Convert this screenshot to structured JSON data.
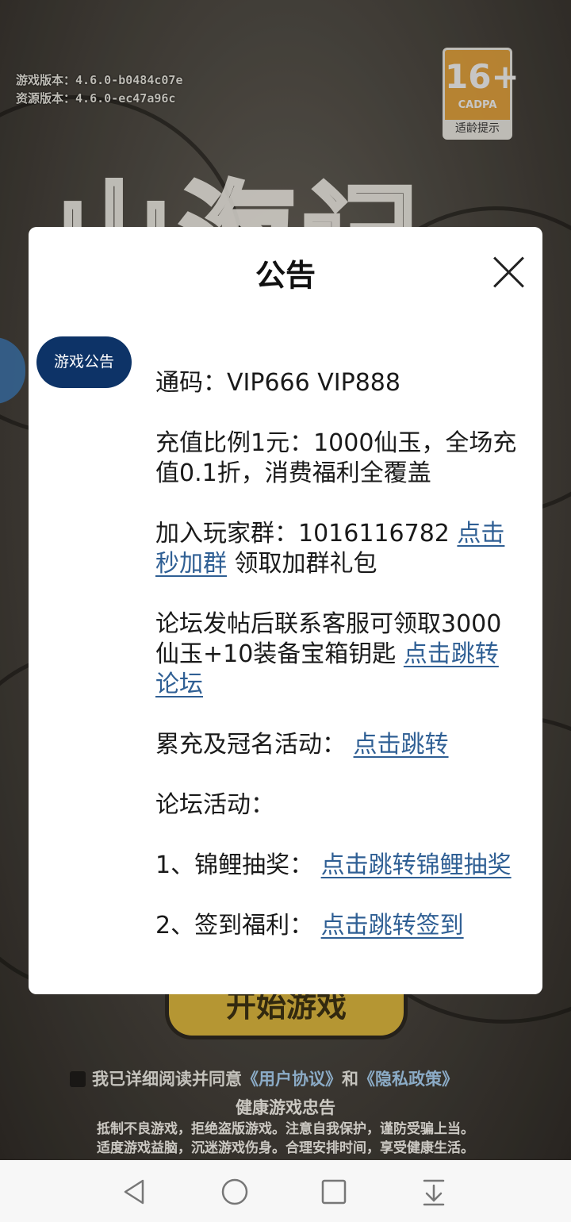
{
  "background": {
    "game_version_label": "游戏版本：",
    "game_version": "4.6.0-b0484c07e",
    "resource_version_label": "资源版本：",
    "resource_version": "4.6.0-ec47a96c",
    "age_rating": {
      "rating": "16+",
      "org": "CADPA",
      "tip": "适龄提示"
    },
    "logo_text": "山海记",
    "start_button": "开始游戏",
    "agreement": {
      "prefix": "我已详细阅读并同意",
      "user_agreement": "《用户协议》",
      "and": "和",
      "privacy_policy": "《隐私政策》"
    },
    "health_title": "健康游戏忠告",
    "health_line1": "抵制不良游戏，拒绝盗版游戏。注意自我保护，谨防受骗上当。",
    "health_line2": "适度游戏益脑，沉迷游戏伤身。合理安排时间，享受健康生活。"
  },
  "dialog": {
    "title": "公告",
    "tab": "游戏公告",
    "code_text": "通码：VIP666 VIP888",
    "recharge_text": "充值比例1元：1000仙玉，全场充值0.1折，消费福利全覆盖",
    "group_text": "加入玩家群：1016116782 ",
    "group_link": "点击秒加群",
    "group_suffix": " 领取加群礼包",
    "forum_text": "论坛发帖后联系客服可领取3000仙玉+10装备宝箱钥匙 ",
    "forum_link": "点击跳转论坛",
    "cumulative_text": "累充及冠名活动：  ",
    "cumulative_link": "点击跳转",
    "forum_activity": "论坛活动：",
    "koi_text": "1、锦鲤抽奖：  ",
    "koi_link": "点击跳转锦鲤抽奖",
    "signin_text": "2、签到福利：  ",
    "signin_link": "点击跳转签到"
  },
  "navbar": {
    "back": "back-icon",
    "home": "home-icon",
    "recents": "recents-icon",
    "notification": "pull-down-icon"
  }
}
